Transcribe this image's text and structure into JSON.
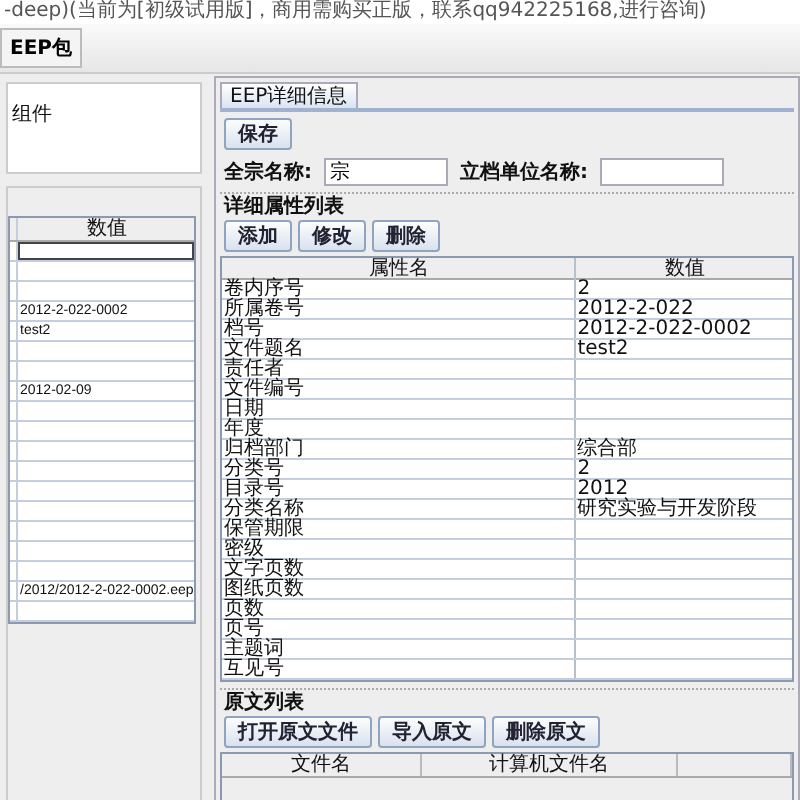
{
  "window": {
    "title": "-deep)(当前为[初级试用版]，商用需购买正版，联系qq942225168,进行咨询)"
  },
  "toolbar": {
    "buttons": [
      "EEP包"
    ]
  },
  "left_panel": {
    "component_label": "组件",
    "table": {
      "columns": [
        "数值"
      ],
      "rows": [
        {
          "value": "",
          "selected": true
        },
        {
          "value": "",
          "selected": false
        },
        {
          "value": "",
          "selected": false
        },
        {
          "value": "2012-2-022-0002",
          "selected": false
        },
        {
          "value": "test2",
          "selected": false
        },
        {
          "value": "",
          "selected": false
        },
        {
          "value": "",
          "selected": false
        },
        {
          "value": "2012-02-09",
          "selected": false
        },
        {
          "value": "",
          "selected": false
        },
        {
          "value": "",
          "selected": false
        },
        {
          "value": "",
          "selected": false
        },
        {
          "value": "",
          "selected": false
        },
        {
          "value": "",
          "selected": false
        },
        {
          "value": "",
          "selected": false
        },
        {
          "value": "",
          "selected": false
        },
        {
          "value": "",
          "selected": false
        },
        {
          "value": "",
          "selected": false
        },
        {
          "value": "/2012/2012-2-022-0002.eep",
          "selected": false
        },
        {
          "value": "",
          "selected": false
        }
      ]
    }
  },
  "detail_panel": {
    "tabs": [
      {
        "label": "EEP详细信息",
        "selected": true
      }
    ],
    "save_button": "保存",
    "fields": [
      {
        "label": "全宗名称:",
        "value": "宗"
      },
      {
        "label": "立档单位名称:"
      }
    ],
    "attributes": {
      "title": "详细属性列表",
      "buttons": [
        "添加",
        "修改",
        "删除"
      ],
      "columns": [
        "属性名",
        "数值"
      ],
      "rows": [
        [
          "卷内序号",
          "2"
        ],
        [
          "所属卷号",
          "2012-2-022"
        ],
        [
          "档号",
          "2012-2-022-0002"
        ],
        [
          "文件题名",
          "test2"
        ],
        [
          "责任者",
          ""
        ],
        [
          "文件编号",
          ""
        ],
        [
          "日期",
          ""
        ],
        [
          "年度",
          ""
        ],
        [
          "归档部门",
          "综合部"
        ],
        [
          "分类号",
          "2"
        ],
        [
          "目录号",
          "2012"
        ],
        [
          "分类名称",
          "研究实验与开发阶段"
        ],
        [
          "保管期限",
          ""
        ],
        [
          "密级",
          ""
        ],
        [
          "文字页数",
          ""
        ],
        [
          "图纸页数",
          ""
        ],
        [
          "页数",
          ""
        ],
        [
          "页号",
          ""
        ],
        [
          "主题词",
          ""
        ],
        [
          "互见号",
          ""
        ]
      ]
    },
    "originals": {
      "title": "原文列表",
      "buttons": [
        "打开原文文件",
        "导入原文",
        "删除原文"
      ],
      "columns": [
        "文件名",
        "计算机文件名"
      ]
    }
  }
}
